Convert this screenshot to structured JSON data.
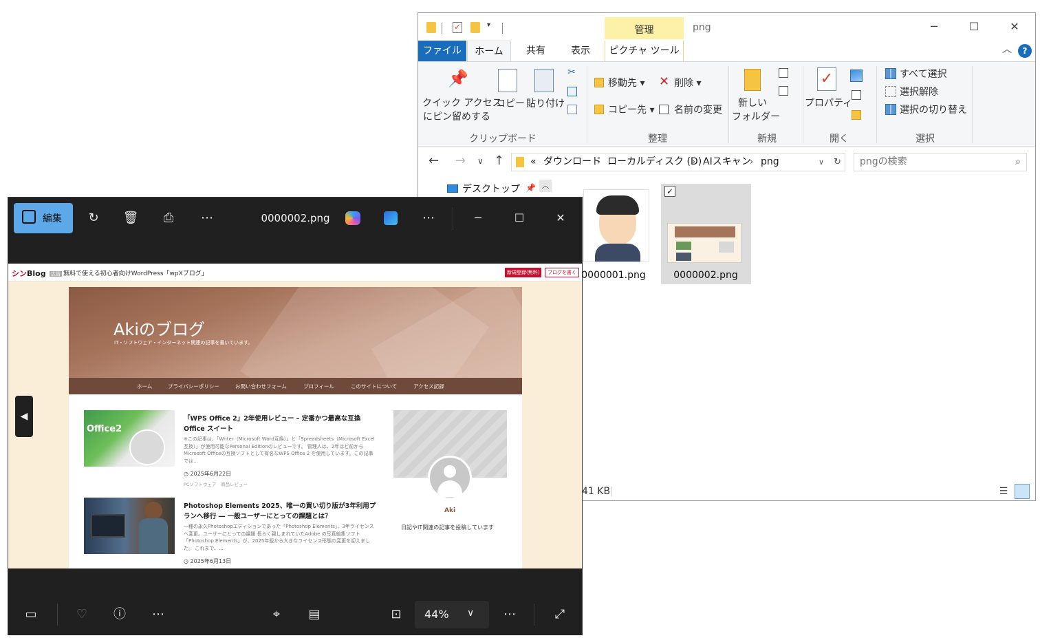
{
  "explorer": {
    "title": "png",
    "context_tab": "管理",
    "tabs": [
      "ファイル",
      "ホーム",
      "共有",
      "表示",
      "ピクチャ ツール"
    ],
    "ribbon": {
      "pin_label_1": "クイック アクセス",
      "pin_label_2": "にピン留めする",
      "copy": "コピー",
      "paste": "貼り付け",
      "group_clipboard": "クリップボード",
      "move_to": "移動先",
      "copy_to": "コピー先",
      "delete": "削除",
      "rename": "名前の変更",
      "group_organize": "整理",
      "new_folder_1": "新しい",
      "new_folder_2": "フォルダー",
      "group_new": "新規",
      "properties": "プロパティ",
      "group_open": "開く",
      "select_all": "すべて選択",
      "select_none": "選択解除",
      "invert_selection": "選択の切り替え",
      "group_select": "選択"
    },
    "breadcrumb_overflow": "«",
    "breadcrumb": [
      "ダウンロード",
      "ローカルディスク (D)",
      "AIスキャン",
      "png"
    ],
    "search_placeholder": "pngの検索",
    "nav_item": "デスクトップ",
    "files": [
      "0000001.png",
      "0000002.png"
    ],
    "status_size": "41 KB"
  },
  "photos": {
    "edit_label": "編集",
    "filename": "0000002.png",
    "zoom": "44%",
    "image": {
      "site_logo_prefix": "シン",
      "site_logo_suffix": "Blog",
      "ad_tag": "広告",
      "ad_text": "無料で使える初心者向けWordPress「wpXブログ」",
      "btn_signup": "新規登録(無料)",
      "btn_write": "ブログを書く",
      "blog_title": "Akiのブログ",
      "blog_tagline": "IT・ソフトウェア・インターネット関連の記事を書いています。",
      "nav": [
        "ホーム",
        "プライバシーポリシー",
        "お問い合わせフォーム",
        "プロフィール",
        "このサイトについて",
        "アクセス記録"
      ],
      "posts": [
        {
          "title": "「WPS Office 2」2年使用レビュー – 定番かつ最高な互換Office スイート",
          "excerpt": "※この記事は、「Writer（Microsoft Word互換）」と「Spreadsheets（Microsoft Excel互換）」が使用可能なPersonal Editionのレビューです。 管理人は、2年ほど前からMicrosoft Officeの互換ソフトとして有名なWPS Office 2 を使用しています。この記事では…",
          "date": "2025年6月22日",
          "cats": "PCソフトウェア　商品レビュー"
        },
        {
          "title": "Photoshop Elements 2025、唯一の買い切り版が3年利用プランへ移行 ― 一般ユーザーにとっての課題とは？",
          "excerpt": "一種の永久Photoshopエディションであった「Photoshop Elements」、3年ライセンスへ変更。ユーザーにとっての課題 長らく親しまれていたAdobe の写真編集ソフト「Photoshop Elements」が、2025年版から大きなライセンス形態の変更を迎えました。 これまで、…",
          "date": "2025年6月13日"
        }
      ],
      "author": "Aki",
      "author_bio": "日記やIT関連の記事を投稿しています"
    }
  }
}
